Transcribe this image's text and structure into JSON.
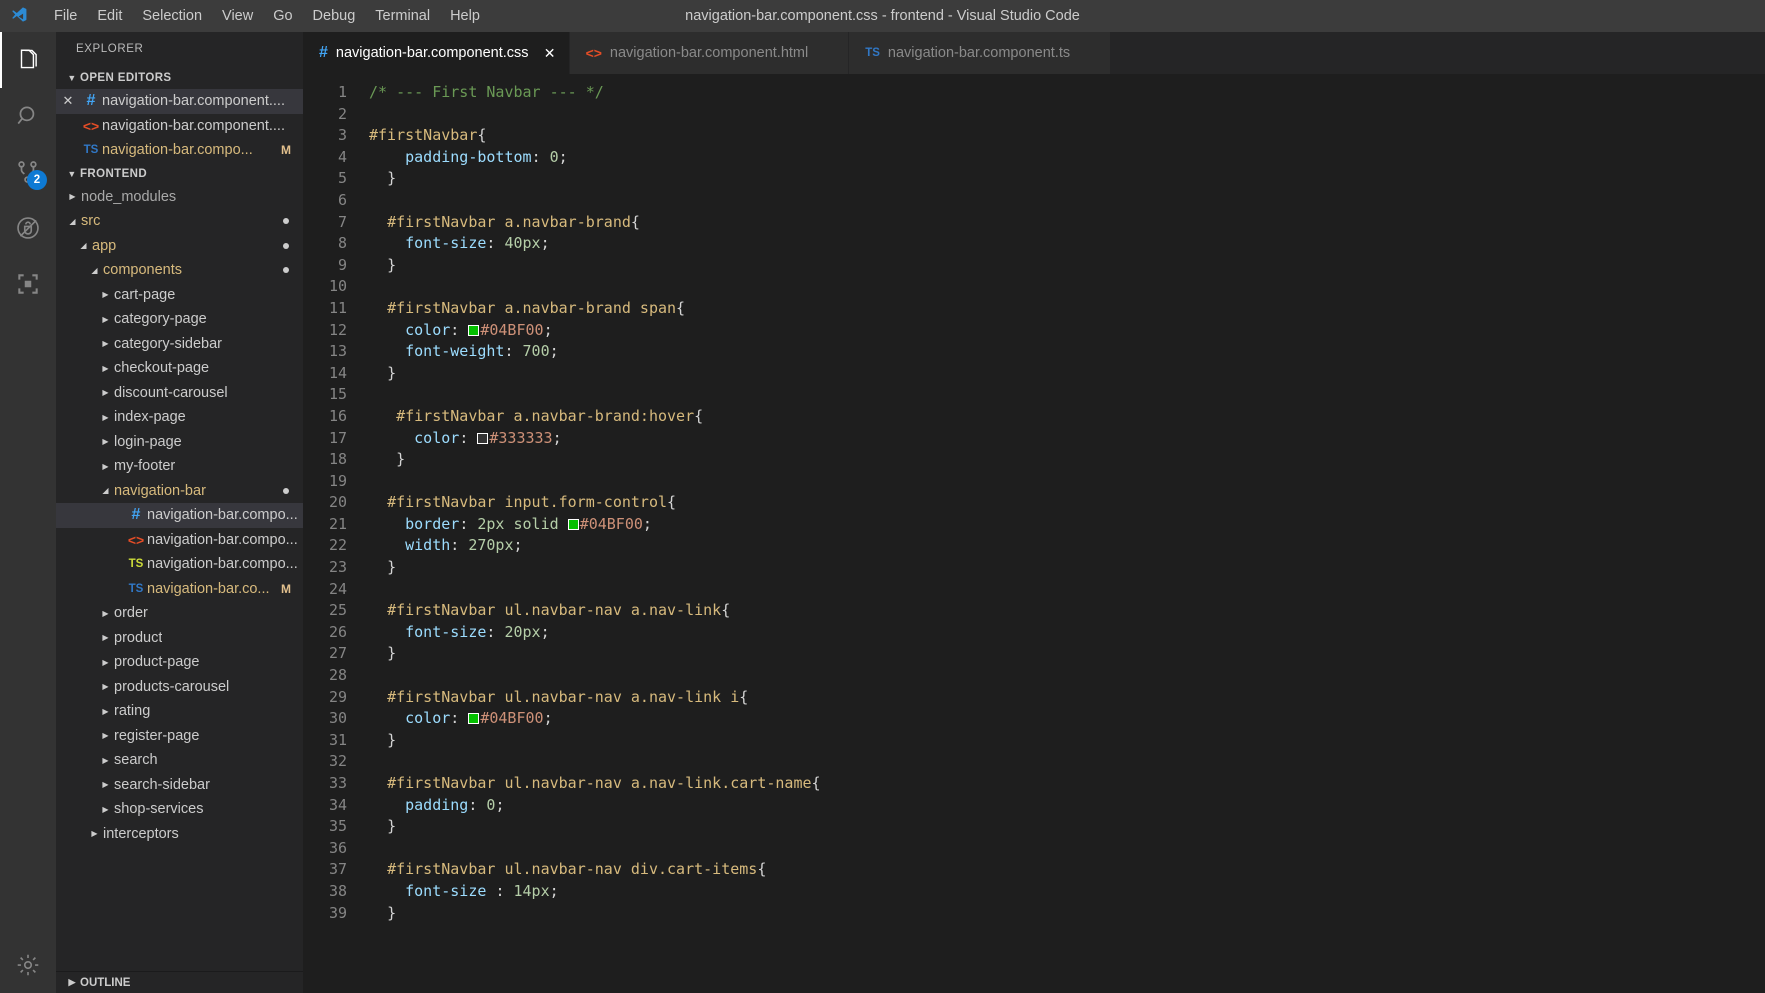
{
  "titlebar": {
    "logo_icon": "vscode-logo-icon",
    "window_title": "navigation-bar.component.css - frontend - Visual Studio Code",
    "menus": [
      "File",
      "Edit",
      "Selection",
      "View",
      "Go",
      "Debug",
      "Terminal",
      "Help"
    ]
  },
  "activitybar": {
    "items": [
      {
        "icon": "files-explorer-icon",
        "name": "explorer",
        "active": true,
        "badge": null
      },
      {
        "icon": "search-icon",
        "name": "search",
        "active": false,
        "badge": null
      },
      {
        "icon": "source-control-branch-icon",
        "name": "source-control",
        "active": false,
        "badge": "2"
      },
      {
        "icon": "run-debug-icon",
        "name": "debug",
        "active": false,
        "badge": null
      },
      {
        "icon": "extensions-icon",
        "name": "extensions",
        "active": false,
        "badge": null
      }
    ],
    "bottom": [
      {
        "icon": "gear-icon",
        "name": "manage-settings",
        "active": false,
        "badge": null
      }
    ],
    "badge_color": "#0e7ad4"
  },
  "sidebar": {
    "title": "EXPLORER",
    "open_editors": {
      "header": "OPEN EDITORS",
      "expanded": true,
      "items": [
        {
          "icon": "css",
          "label": "navigation-bar.component....",
          "selected": true,
          "closable": true,
          "badge": ""
        },
        {
          "icon": "html",
          "label": "navigation-bar.component....",
          "selected": false,
          "closable": false,
          "badge": ""
        },
        {
          "icon": "ts",
          "label": "navigation-bar.compo...",
          "selected": false,
          "closable": false,
          "badge": "M",
          "modified": true
        }
      ]
    },
    "workspace": {
      "header": "FRONTEND",
      "expanded": true,
      "tree": [
        {
          "label": "node_modules",
          "indent": 1,
          "type": "folder",
          "open": false,
          "modified": false,
          "dim": true
        },
        {
          "label": "src",
          "indent": 1,
          "type": "folder",
          "open": true,
          "modified": true,
          "dot": true
        },
        {
          "label": "app",
          "indent": 2,
          "type": "folder",
          "open": true,
          "modified": true,
          "dot": true
        },
        {
          "label": "components",
          "indent": 3,
          "type": "folder",
          "open": true,
          "modified": true,
          "dot": true
        },
        {
          "label": "cart-page",
          "indent": 4,
          "type": "folder",
          "open": false,
          "modified": false
        },
        {
          "label": "category-page",
          "indent": 4,
          "type": "folder",
          "open": false,
          "modified": false
        },
        {
          "label": "category-sidebar",
          "indent": 4,
          "type": "folder",
          "open": false,
          "modified": false
        },
        {
          "label": "checkout-page",
          "indent": 4,
          "type": "folder",
          "open": false,
          "modified": false
        },
        {
          "label": "discount-carousel",
          "indent": 4,
          "type": "folder",
          "open": false,
          "modified": false
        },
        {
          "label": "index-page",
          "indent": 4,
          "type": "folder",
          "open": false,
          "modified": false
        },
        {
          "label": "login-page",
          "indent": 4,
          "type": "folder",
          "open": false,
          "modified": false
        },
        {
          "label": "my-footer",
          "indent": 4,
          "type": "folder",
          "open": false,
          "modified": false
        },
        {
          "label": "navigation-bar",
          "indent": 4,
          "type": "folder",
          "open": true,
          "modified": true,
          "dot": true
        },
        {
          "label": "navigation-bar.compo...",
          "indent": 5,
          "type": "css",
          "selected": true,
          "modified": false
        },
        {
          "label": "navigation-bar.compo...",
          "indent": 5,
          "type": "html",
          "modified": false
        },
        {
          "label": "navigation-bar.compo...",
          "indent": 5,
          "type": "tsspec",
          "modified": false
        },
        {
          "label": "navigation-bar.co...",
          "indent": 5,
          "type": "ts",
          "modified": true,
          "badge": "M"
        },
        {
          "label": "order",
          "indent": 4,
          "type": "folder",
          "open": false,
          "modified": false
        },
        {
          "label": "product",
          "indent": 4,
          "type": "folder",
          "open": false,
          "modified": false
        },
        {
          "label": "product-page",
          "indent": 4,
          "type": "folder",
          "open": false,
          "modified": false
        },
        {
          "label": "products-carousel",
          "indent": 4,
          "type": "folder",
          "open": false,
          "modified": false
        },
        {
          "label": "rating",
          "indent": 4,
          "type": "folder",
          "open": false,
          "modified": false
        },
        {
          "label": "register-page",
          "indent": 4,
          "type": "folder",
          "open": false,
          "modified": false
        },
        {
          "label": "search",
          "indent": 4,
          "type": "folder",
          "open": false,
          "modified": false
        },
        {
          "label": "search-sidebar",
          "indent": 4,
          "type": "folder",
          "open": false,
          "modified": false
        },
        {
          "label": "shop-services",
          "indent": 4,
          "type": "folder",
          "open": false,
          "modified": false
        },
        {
          "label": "interceptors",
          "indent": 3,
          "type": "folder",
          "open": false,
          "modified": false
        }
      ]
    },
    "outline": {
      "header": "OUTLINE",
      "expanded": false
    }
  },
  "tabs": [
    {
      "icon": "css",
      "label": "navigation-bar.component.css",
      "active": true,
      "close_icon": "close-icon"
    },
    {
      "icon": "html",
      "label": "navigation-bar.component.html",
      "active": false,
      "close_icon": "close-icon"
    },
    {
      "icon": "ts",
      "label": "navigation-bar.component.ts",
      "active": false,
      "close_icon": "close-icon"
    }
  ],
  "editor": {
    "language": "css",
    "first_line": 1,
    "line_numbers": [
      1,
      2,
      3,
      4,
      5,
      6,
      7,
      8,
      9,
      10,
      11,
      12,
      13,
      14,
      15,
      16,
      17,
      18,
      19,
      20,
      21,
      22,
      23,
      24,
      25,
      26,
      27,
      28,
      29,
      30,
      31,
      32,
      33,
      34,
      35,
      36,
      37,
      38,
      39
    ],
    "code_lines": [
      "/* --- First Navbar --- */",
      "",
      "#firstNavbar{",
      "    padding-bottom: 0;",
      "  }",
      "",
      "  #firstNavbar a.navbar-brand{",
      "    font-size: 40px;",
      "  }",
      "",
      "  #firstNavbar a.navbar-brand span{",
      "    color: #04BF00;",
      "    font-weight: 700;",
      "  }",
      "",
      "   #firstNavbar a.navbar-brand:hover{",
      "     color: #333333;",
      "   }",
      "",
      "  #firstNavbar input.form-control{",
      "    border: 2px solid #04BF00;",
      "    width: 270px;",
      "  }",
      "",
      "  #firstNavbar ul.navbar-nav a.nav-link{",
      "    font-size: 20px;",
      "  }",
      "",
      "  #firstNavbar ul.navbar-nav a.nav-link i{",
      "    color: #04BF00;",
      "  }",
      "",
      "  #firstNavbar ul.navbar-nav a.nav-link.cart-name{",
      "    padding: 0;",
      "  }",
      "",
      "  #firstNavbar ul.navbar-nav div.cart-items{",
      "    font-size : 14px;",
      "  }"
    ],
    "color_literals": [
      {
        "line": 12,
        "value": "#04BF00"
      },
      {
        "line": 17,
        "value": "#333333"
      },
      {
        "line": 21,
        "value": "#04BF00"
      },
      {
        "line": 30,
        "value": "#04BF00"
      }
    ],
    "theme_colors": {
      "background": "#1e1e1e",
      "comment": "#6a9955",
      "selector": "#d7ba7d",
      "property": "#9cdcfe",
      "number": "#b5cea8",
      "color_literal": "#ce9178",
      "punctuation": "#d4d4d4",
      "line_number": "#858585"
    }
  }
}
